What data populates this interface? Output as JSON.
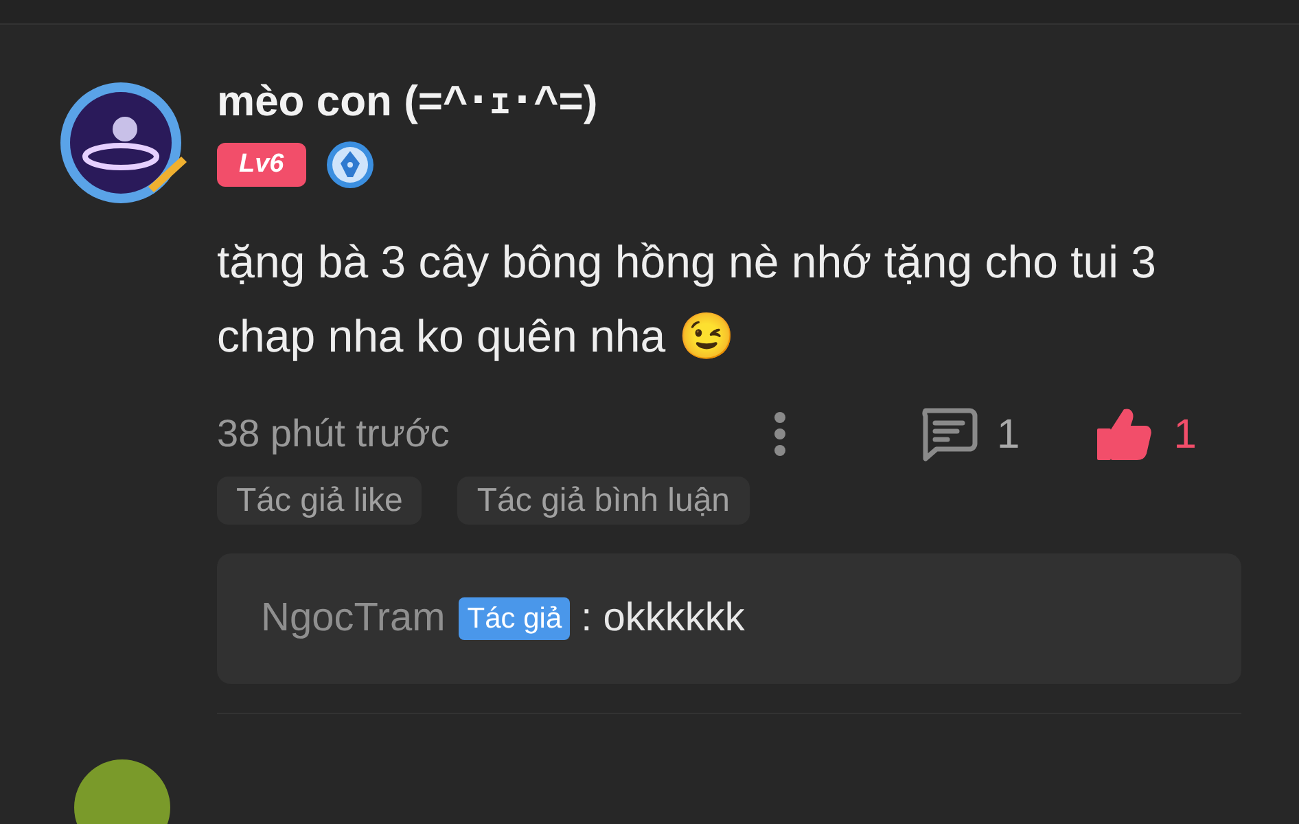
{
  "comment": {
    "author": "mèo con (=^･ｪ･^=)",
    "level": "Lv6",
    "content": "tặng bà 3 cây bông hồng nè nhớ tặng cho tui 3 chap nha ko quên nha 😉",
    "time": "38 phút trước",
    "reply_count": "1",
    "like_count": "1",
    "liked": true
  },
  "tags": [
    "Tác giả like",
    "Tác giả bình luận"
  ],
  "replies": [
    {
      "author": "NgocTram",
      "badge": "Tác giả",
      "text": ": okkkkkk"
    }
  ]
}
